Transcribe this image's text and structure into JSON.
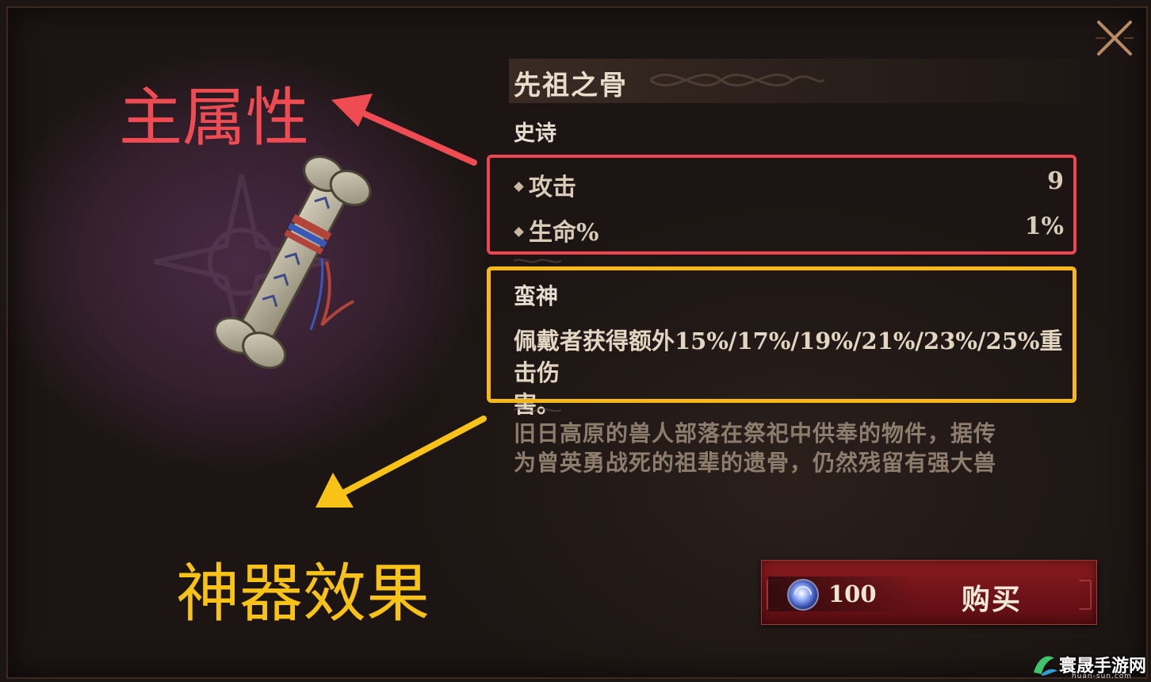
{
  "item": {
    "name": "先祖之骨",
    "rarity": "史诗"
  },
  "main_stats": {
    "rows": [
      {
        "label": "攻击",
        "value": "9"
      },
      {
        "label": "生命%",
        "value": "1%"
      }
    ]
  },
  "artifact_effect": {
    "name": "蛮神",
    "description_line1": "佩戴者获得额外15%/17%/19%/21%/23%/25%重击伤",
    "description_line2": "害。"
  },
  "lore": {
    "line1": "旧日高原的兽人部落在祭祀中供奉的物件，据传",
    "line2": "为曾英勇战死的祖辈的遗骨，仍然残留有强大兽"
  },
  "purchase": {
    "price": "100",
    "button_label": "购买",
    "currency_icon": "blue-gem-icon"
  },
  "annotations": {
    "main_stats_label": "主属性",
    "artifact_effect_label": "神器效果",
    "colors": {
      "red": "#ee4b52",
      "yellow": "#f8c216"
    }
  },
  "watermark": {
    "text": "寰晟手游网",
    "sub": "huan-sun.com"
  }
}
